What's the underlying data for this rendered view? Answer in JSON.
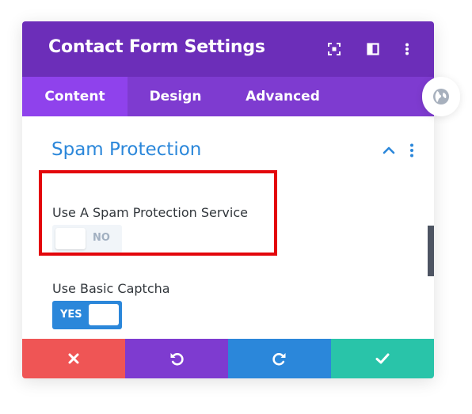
{
  "modal": {
    "title": "Contact Form Settings",
    "header_icons": [
      "focus-icon",
      "split-layout-icon",
      "more-options-icon"
    ]
  },
  "tabs": [
    {
      "label": "Content",
      "active": true
    },
    {
      "label": "Design",
      "active": false
    },
    {
      "label": "Advanced",
      "active": false
    }
  ],
  "section": {
    "title": "Spam Protection",
    "expanded": true
  },
  "fields": {
    "spam_service": {
      "label": "Use A Spam Protection Service",
      "value": "NO",
      "enabled": false
    },
    "basic_captcha": {
      "label": "Use Basic Captcha",
      "value": "YES",
      "enabled": true
    }
  },
  "footer": {
    "buttons": [
      {
        "icon": "close-icon",
        "color": "#ef5555"
      },
      {
        "icon": "undo-icon",
        "color": "#7e3bd0"
      },
      {
        "icon": "redo-icon",
        "color": "#2b87da"
      },
      {
        "icon": "check-icon",
        "color": "#29c4a9"
      }
    ]
  },
  "colors": {
    "header": "#6c2eb9",
    "tabs": "#7e3bd0",
    "active_tab": "#8f42ec",
    "accent_blue": "#2b87da",
    "highlight_red": "#e3060b"
  },
  "side_icon": "globe-icon"
}
